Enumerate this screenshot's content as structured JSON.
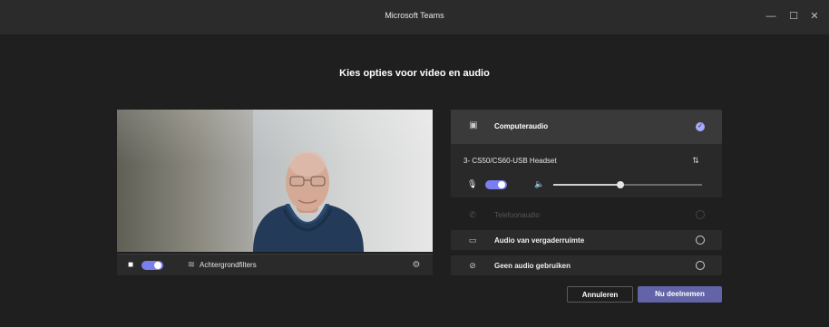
{
  "window": {
    "title": "Microsoft Teams",
    "controls": {
      "minimize_icon": "minimize-icon",
      "maximize_icon": "maximize-icon",
      "close_icon": "close-icon",
      "minimize_glyph": "—",
      "maximize_glyph": "☐",
      "close_glyph": "✕"
    }
  },
  "main": {
    "heading": "Kies opties voor video en audio",
    "video": {
      "camera_toggle_on": true,
      "background_filters_label": "Achtergrondfilters",
      "camera_icon": "camera-icon",
      "background_icon": "background-filter-icon",
      "settings_icon": "gear-icon",
      "camera_glyph": "■",
      "background_glyph": "≋",
      "settings_glyph": "⚙"
    },
    "audio": {
      "computer_audio": {
        "label": "Computeraudio",
        "selected": true,
        "icon": "computer-audio-icon",
        "icon_glyph": "▣",
        "check_glyph": "✓"
      },
      "device": "3- CS50/CS60-USB Headset",
      "device_settings_glyph": "⇅",
      "mic_on": true,
      "mic_glyph": "🎙",
      "speaker_glyph": "🔈",
      "volume": 0.45,
      "options": [
        {
          "label": "Telefoonaudio",
          "icon": "phone-icon",
          "glyph": "✆",
          "enabled": false,
          "selected": false
        },
        {
          "label": "Audio van vergaderruimte",
          "icon": "room-audio-icon",
          "glyph": "▭",
          "enabled": true,
          "selected": false
        },
        {
          "label": "Geen audio gebruiken",
          "icon": "no-audio-icon",
          "glyph": "⊘",
          "enabled": true,
          "selected": false
        }
      ]
    },
    "buttons": {
      "cancel": "Annuleren",
      "join": "Nu deelnemen"
    },
    "colors": {
      "accent": "#6264a7",
      "toggle": "#7a7ff0",
      "check": "#a6a9ff",
      "background": "#1f1f1f"
    }
  }
}
